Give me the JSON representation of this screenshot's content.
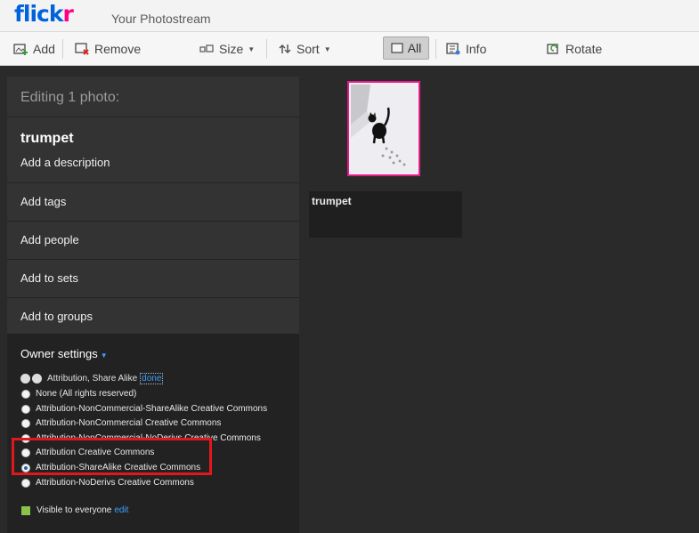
{
  "header": {
    "logo_main": "flick",
    "logo_accent": "r",
    "page_title": "Your Photostream"
  },
  "toolbar": {
    "add": "Add",
    "remove": "Remove",
    "size": "Size",
    "sort": "Sort",
    "all": "All",
    "info": "Info",
    "rotate": "Rotate"
  },
  "panel": {
    "editing_label": "Editing 1 photo:",
    "photo_title": "trumpet",
    "add_description": "Add a description",
    "rows": [
      "Add tags",
      "Add people",
      "Add to sets",
      "Add to groups"
    ],
    "owner_settings": "Owner settings",
    "current_license": "Attribution, Share Alike",
    "done_link": "done",
    "license_options": [
      {
        "label": "None (All rights reserved)",
        "selected": false
      },
      {
        "label": "Attribution-NonCommercial-ShareAlike Creative Commons",
        "selected": false
      },
      {
        "label": "Attribution-NonCommercial Creative Commons",
        "selected": false
      },
      {
        "label": "Attribution-NonCommercial-NoDerivs Creative Commons",
        "selected": false
      },
      {
        "label": "Attribution Creative Commons",
        "selected": false
      },
      {
        "label": "Attribution-ShareAlike Creative Commons",
        "selected": true
      },
      {
        "label": "Attribution-NoDerivs Creative Commons",
        "selected": false
      }
    ],
    "visibility": "Visible to everyone",
    "edit_link": "edit"
  },
  "thumbnail": {
    "caption": "trumpet"
  },
  "colors": {
    "brand_blue": "#0063dc",
    "brand_pink": "#ff0084",
    "highlight_red": "#e0181c"
  }
}
